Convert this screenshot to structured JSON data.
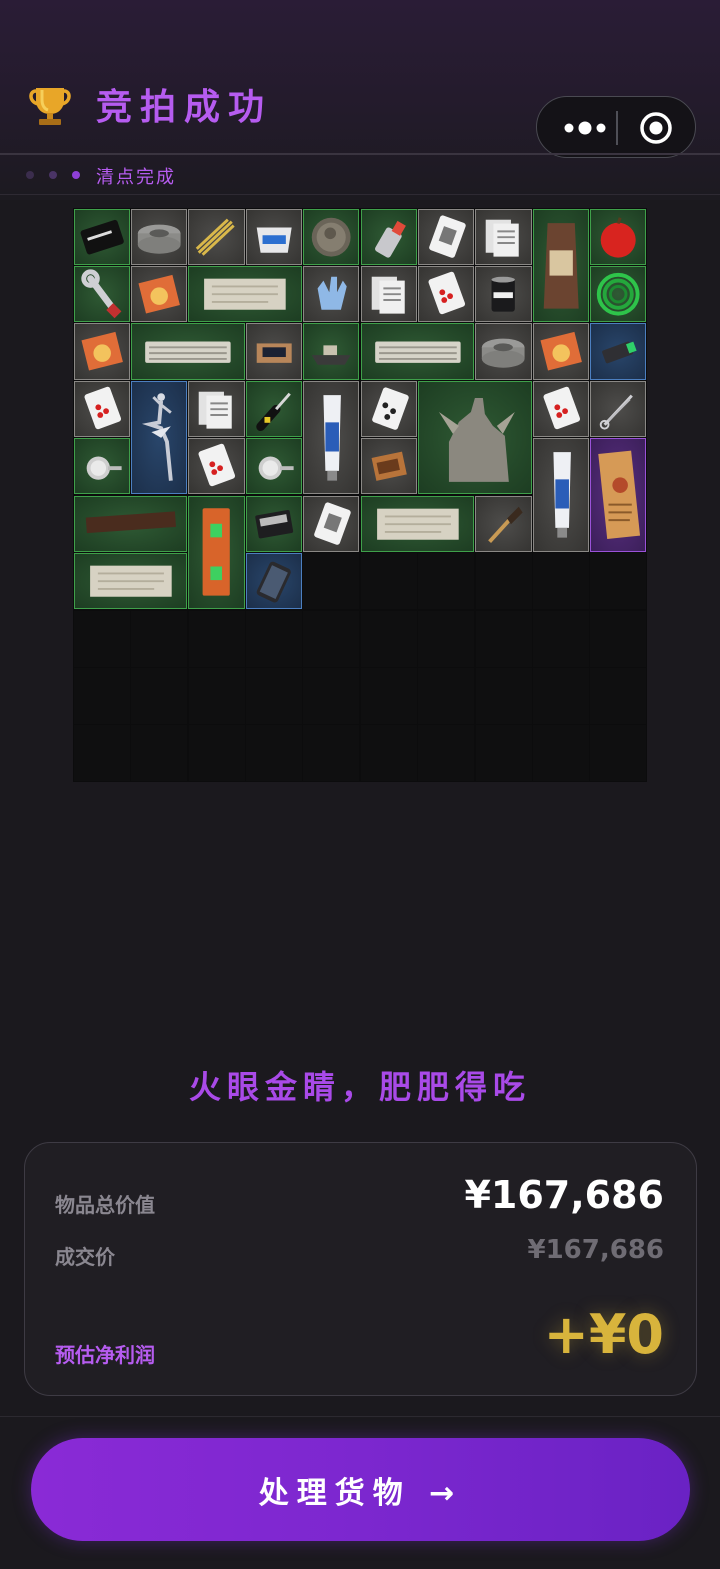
{
  "header": {
    "title": "竞拍成功",
    "trophy_icon": "trophy-icon",
    "more_icon": "more-dots-icon",
    "close_icon": "target-circle-icon"
  },
  "progress": {
    "steps_total": 3,
    "dot_colors": [
      "#3b2d4d",
      "#4a3466",
      "#8e3fd6"
    ],
    "status": "清点完成"
  },
  "inventory": {
    "grid_cols": 10,
    "grid_rows": 10,
    "items": [
      {
        "name": "good-luck-card",
        "rarity": "green"
      },
      {
        "name": "duct-tape",
        "rarity": "gray"
      },
      {
        "name": "rope-bundle",
        "rarity": "gray"
      },
      {
        "name": "takeout-box",
        "rarity": "gray"
      },
      {
        "name": "coin",
        "rarity": "green"
      },
      {
        "name": "lighter",
        "rarity": "green"
      },
      {
        "name": "joker-card",
        "rarity": "gray"
      },
      {
        "name": "receipts",
        "rarity": "gray"
      },
      {
        "name": "coffee-bag",
        "rarity": "green"
      },
      {
        "name": "apple",
        "rarity": "green"
      },
      {
        "name": "wrench",
        "rarity": "green"
      },
      {
        "name": "instant-noodles",
        "rarity": "gray"
      },
      {
        "name": "old-paper",
        "rarity": "green"
      },
      {
        "name": "rubber-glove",
        "rarity": "gray"
      },
      {
        "name": "receipts",
        "rarity": "gray"
      },
      {
        "name": "heart-card",
        "rarity": "gray"
      },
      {
        "name": "protein-can",
        "rarity": "gray"
      },
      {
        "name": "green-wire",
        "rarity": "green"
      },
      {
        "name": "instant-noodles",
        "rarity": "gray"
      },
      {
        "name": "keyboard",
        "rarity": "green"
      },
      {
        "name": "cardboard-box",
        "rarity": "gray"
      },
      {
        "name": "toy-boat",
        "rarity": "green"
      },
      {
        "name": "keyboard",
        "rarity": "green"
      },
      {
        "name": "duct-tape",
        "rarity": "gray"
      },
      {
        "name": "instant-noodles",
        "rarity": "gray"
      },
      {
        "name": "usb-drive",
        "rarity": "blue"
      },
      {
        "name": "heart-card",
        "rarity": "gray"
      },
      {
        "name": "ballerina-statue",
        "rarity": "blue"
      },
      {
        "name": "receipts",
        "rarity": "gray"
      },
      {
        "name": "screwdriver",
        "rarity": "green"
      },
      {
        "name": "toothpaste",
        "rarity": "gray"
      },
      {
        "name": "spade-card",
        "rarity": "gray"
      },
      {
        "name": "sphinx-statue",
        "rarity": "green"
      },
      {
        "name": "heart-card",
        "rarity": "gray"
      },
      {
        "name": "scissors",
        "rarity": "gray"
      },
      {
        "name": "thermometer",
        "rarity": "green"
      },
      {
        "name": "heart-card",
        "rarity": "gray"
      },
      {
        "name": "thermometer",
        "rarity": "green"
      },
      {
        "name": "matchbox",
        "rarity": "gray"
      },
      {
        "name": "toothpaste",
        "rarity": "gray"
      },
      {
        "name": "paper-document",
        "rarity": "purple"
      },
      {
        "name": "wood-plank",
        "rarity": "green"
      },
      {
        "name": "level-tool",
        "rarity": "green"
      },
      {
        "name": "hard-drive",
        "rarity": "green"
      },
      {
        "name": "joker-card",
        "rarity": "gray"
      },
      {
        "name": "old-paper",
        "rarity": "green"
      },
      {
        "name": "paint-brush",
        "rarity": "gray"
      },
      {
        "name": "old-paper",
        "rarity": "green"
      },
      {
        "name": "smartphone",
        "rarity": "blue"
      }
    ]
  },
  "slogan": "火眼金睛，肥肥得吃",
  "summary": {
    "total_label": "物品总价值",
    "total_value": "¥167,686",
    "deal_label": "成交价",
    "deal_value": "¥167,686",
    "profit_label": "预估净利润",
    "profit_value": "+¥0",
    "colors": {
      "label": "#8a8790",
      "profit_label": "#b65cf0",
      "profit_value": "#d8b43c"
    }
  },
  "action": {
    "label": "处理货物 →"
  },
  "colors": {
    "accent": "#b65cf0",
    "background": "#1b191e"
  }
}
